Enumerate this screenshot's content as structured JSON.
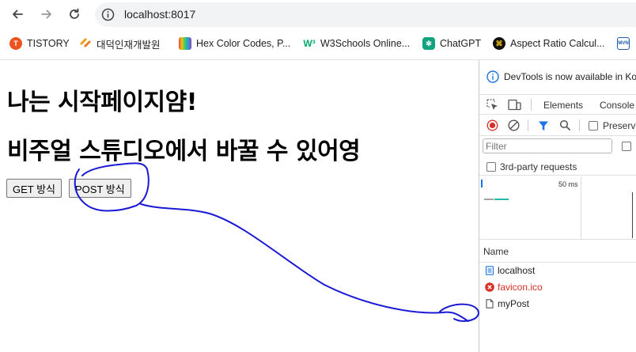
{
  "browser": {
    "url": "localhost:8017",
    "bookmarks": [
      {
        "label": "TISTORY",
        "icon": "tistory-icon",
        "color": "#eb531f"
      },
      {
        "label": "대덕인재개발원",
        "icon": "ddit-logo-icon",
        "color": "#f39c12"
      },
      {
        "label": "Hex Color Codes, P...",
        "icon": "color-book-icon",
        "color": "#8e44ad"
      },
      {
        "label": "W3Schools Online...",
        "icon": "w3schools-icon",
        "color": "#04aa6d"
      },
      {
        "label": "ChatGPT",
        "icon": "chatgpt-icon",
        "color": "#10a37f"
      },
      {
        "label": "Aspect Ratio Calcul...",
        "icon": "aspect-ratio-icon",
        "color": "#f1c40f"
      },
      {
        "label": "",
        "icon": "mvn-icon",
        "color": "#1f5aa6"
      }
    ]
  },
  "page": {
    "heading1": "나는 시작페이지얌!",
    "heading2": "비주얼 스튜디오에서 바꿀 수 있어영",
    "get_button": "GET 방식",
    "post_button": "POST 방식"
  },
  "devtools": {
    "banner": "DevTools is now available in Kor",
    "tabs": [
      "Elements",
      "Console"
    ],
    "preserve_log": "Preserve",
    "filter_placeholder": "Filter",
    "third_party": "3rd-party requests",
    "timeline_label": "50 ms",
    "name_header": "Name",
    "requests": [
      {
        "name": "localhost",
        "icon": "document-icon",
        "color": "#1f1f1f"
      },
      {
        "name": "favicon.ico",
        "icon": "error-icon",
        "color": "#d93025"
      },
      {
        "name": "myPost",
        "icon": "file-icon",
        "color": "#1f1f1f"
      }
    ]
  },
  "colors": {
    "annotation": "#1a1ad6",
    "accent": "#1a73e8",
    "record_red": "#d93025"
  }
}
